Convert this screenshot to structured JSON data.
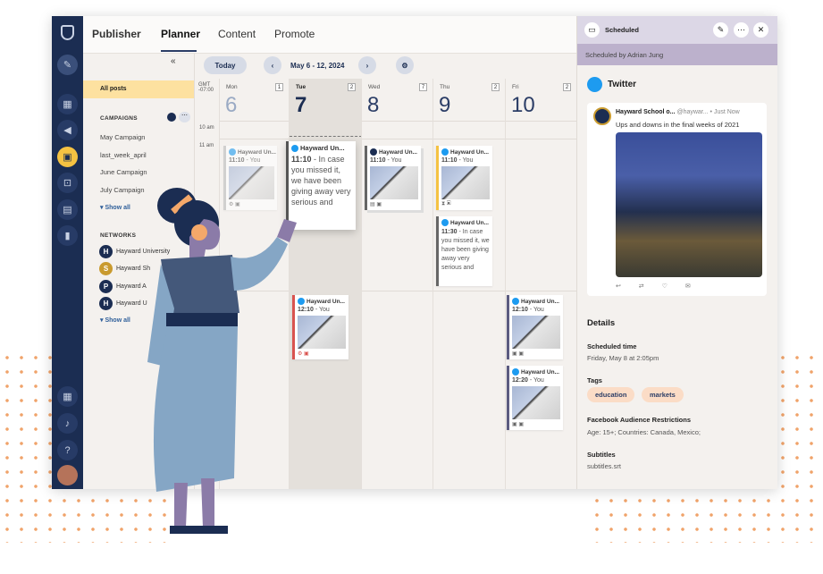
{
  "tabs": {
    "publisher": "Publisher",
    "planner": "Planner",
    "content": "Content",
    "promote": "Promote"
  },
  "toolbar": {
    "today": "Today",
    "range": "May 6 - 12, 2024"
  },
  "sidebar": {
    "all_posts": "All posts",
    "campaigns_title": "CAMPAIGNS",
    "campaigns": [
      "May Campaign",
      "last_week_april",
      "June Campaign",
      "July Campaign"
    ],
    "show_all": "Show all",
    "networks_title": "NETWORKS",
    "networks": [
      "Hayward University",
      "Hayward Sh",
      "Hayward A",
      "Hayward U"
    ]
  },
  "calendar": {
    "tz": "GMT -07:00",
    "times": [
      "10 am",
      "11 am"
    ],
    "days": [
      {
        "name": "Mon",
        "num": "6",
        "count": "1"
      },
      {
        "name": "Tue",
        "num": "7",
        "count": "2"
      },
      {
        "name": "Wed",
        "num": "8",
        "count": "7"
      },
      {
        "name": "Thu",
        "num": "9",
        "count": "2"
      },
      {
        "name": "Fri",
        "num": "10",
        "count": "2"
      }
    ],
    "posts": [
      {
        "account": "Hayward Un...",
        "time": "11:10",
        "by": "You"
      },
      {
        "account": "Hayward Un...",
        "time": "11:10",
        "text": "In case you missed it, we have been giving away very serious and"
      },
      {
        "account": "Hayward Un...",
        "time": "11:10",
        "by": "You"
      },
      {
        "account": "Hayward Un...",
        "time": "11:10",
        "by": "You"
      },
      {
        "account": "Hayward Un...",
        "time": "11:30",
        "text": "In case you missed it, we have been giving away very serious and"
      },
      {
        "account": "Hayward Un...",
        "time": "12:10",
        "by": "You"
      },
      {
        "account": "Hayward Un...",
        "time": "12:10",
        "by": "You"
      },
      {
        "account": "Hayward Un...",
        "time": "12:20",
        "by": "You"
      }
    ]
  },
  "panel": {
    "status": "Scheduled",
    "scheduled_by": "Scheduled by Adrian Jung",
    "network": "Twitter",
    "tweet": {
      "name": "Hayward School o...",
      "handle": "@haywar...",
      "sep": "•",
      "time": "Just Now",
      "text": "Ups and downs in the final weeks of 2021"
    },
    "details_title": "Details",
    "scheduled_time_label": "Scheduled time",
    "scheduled_time": "Friday, May 8 at 2:05pm",
    "tags_label": "Tags",
    "tags": [
      "education",
      "markets"
    ],
    "restrictions_label": "Facebook Audience Restrictions",
    "restrictions": "Age: 15+; Countries: Canada, Mexico;",
    "subtitles_label": "Subtitles",
    "subtitles": "subtitles.srt"
  },
  "colors": {
    "nav": "#1b2d52",
    "accent_active": "#f5c242",
    "all_posts_bg": "#fde1a0",
    "panel_header": "#dcd7e6",
    "panel_sub": "#bcb1cc",
    "tag_bg": "#fbdcc6",
    "twitter": "#1d9bf0",
    "dots": "#f0a36a"
  }
}
